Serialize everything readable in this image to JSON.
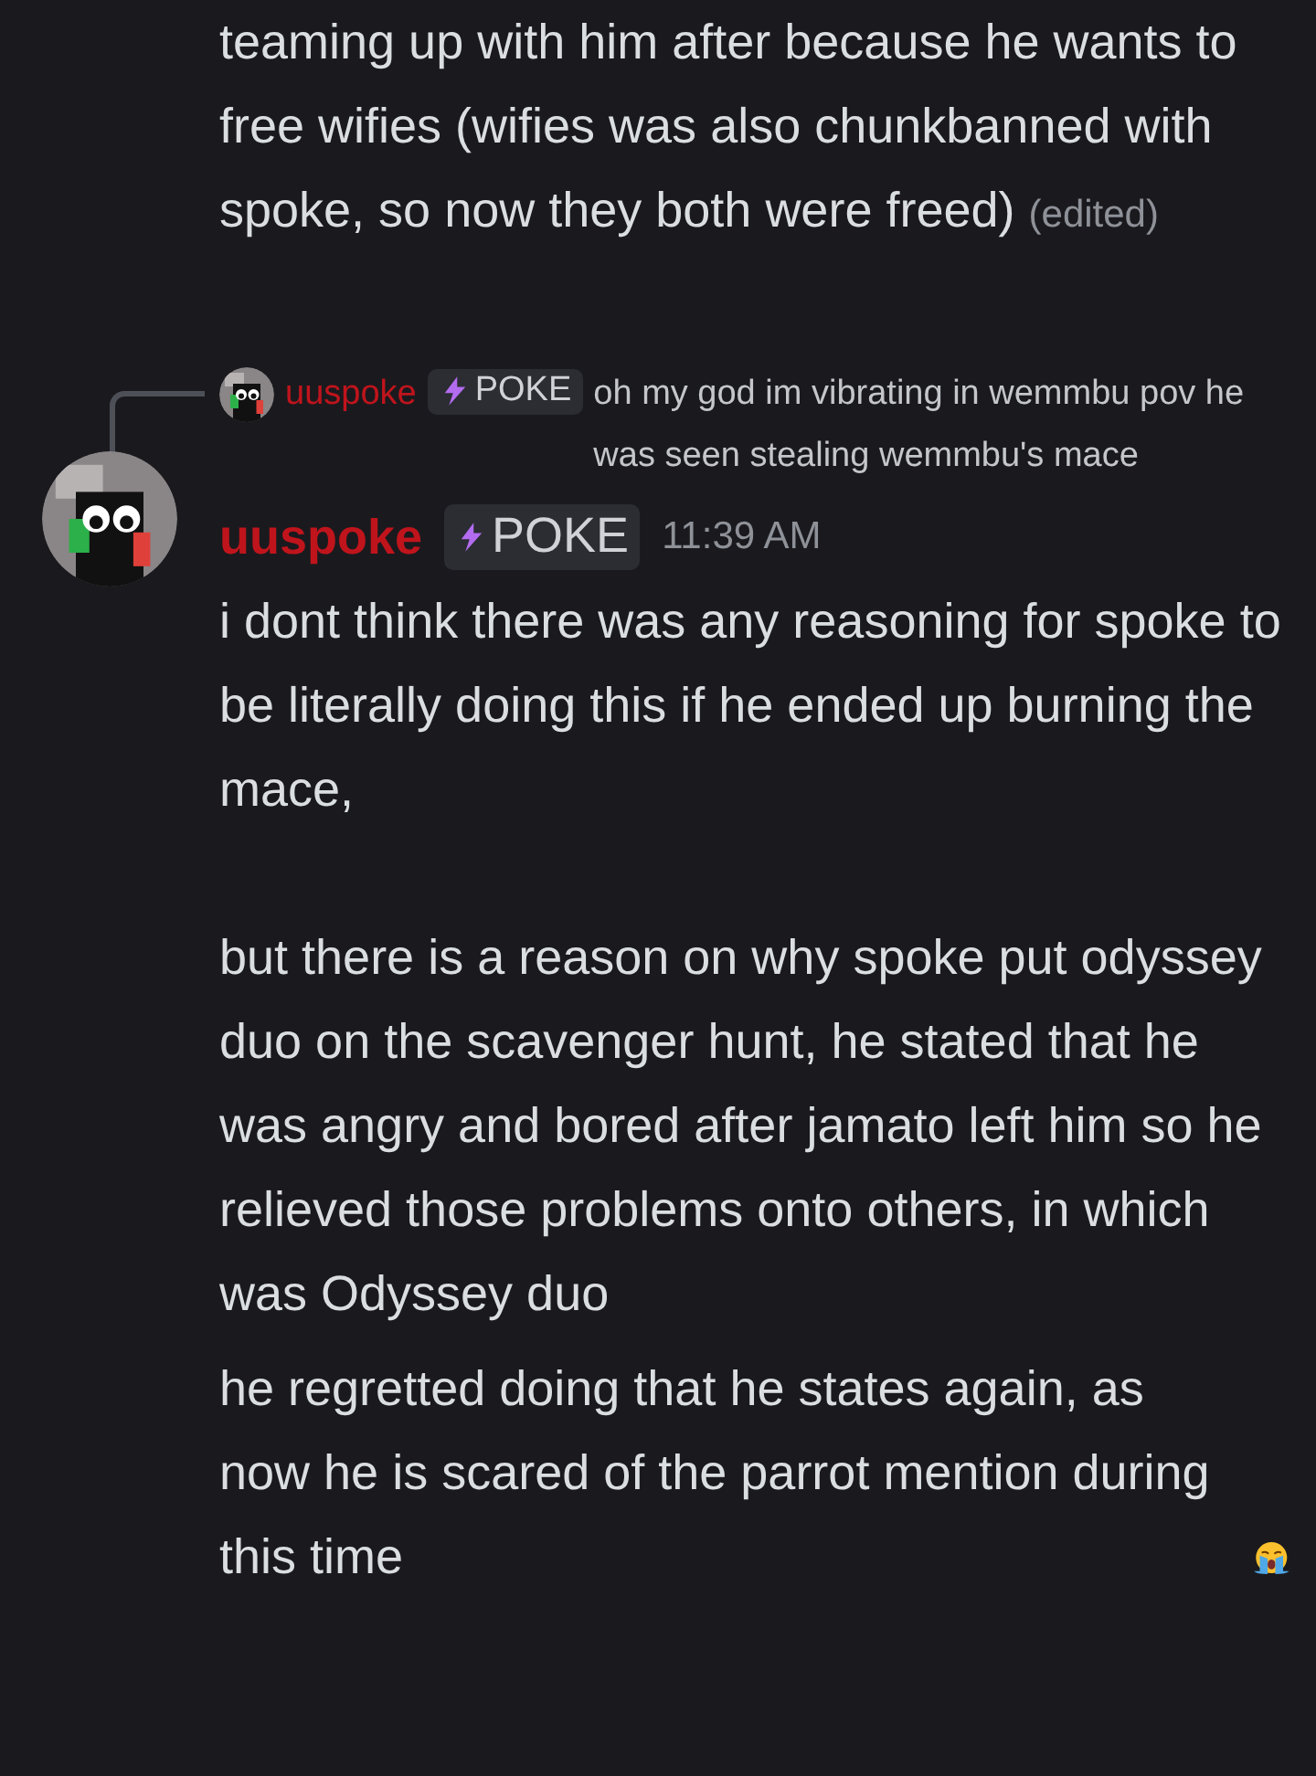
{
  "previous_message": {
    "text": "teaming up with him after because he wants to free wifies (wifies was also chunkbanned with spoke, so now they both were freed)",
    "edited": "(edited)"
  },
  "reply": {
    "author": "uuspoke",
    "tag": "POKE",
    "text": "oh my god im vibrating in wemmbu pov he was seen stealing wemmbu's mace"
  },
  "message": {
    "author": "uuspoke",
    "tag": "POKE",
    "time": "11:39 AM",
    "paragraphs": [
      "i dont think there was any reasoning for spoke to be literally doing this if he ended up burning the mace,",
      "but there is a reason on why spoke put odyssey duo on the scavenger hunt, he stated that he was angry and bored after jamato left him so he relieved those problems onto others, in which was Odyssey duo"
    ]
  },
  "followup": {
    "text": "he regretted doing that he states again, as now he is scared of the parrot mention during this time"
  }
}
